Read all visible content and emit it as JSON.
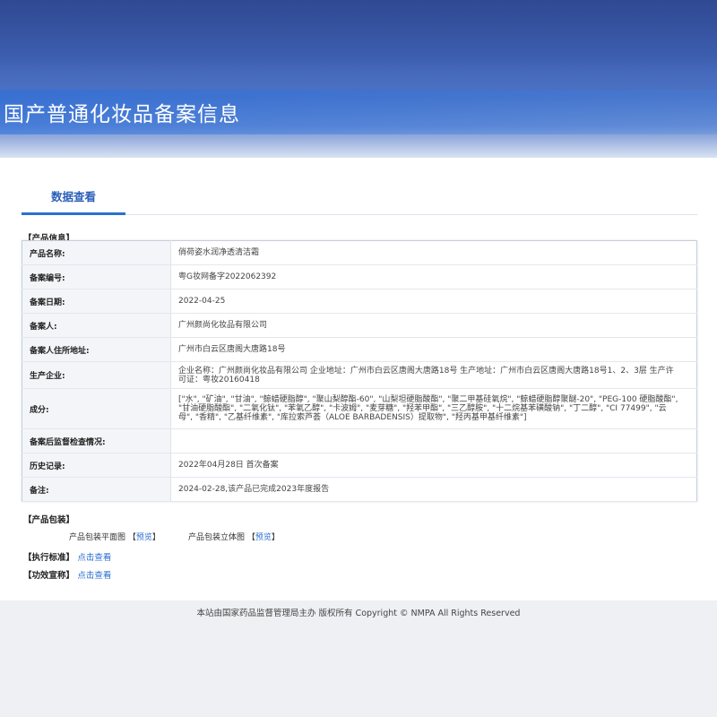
{
  "header": {
    "title": "国产普通化妆品备案信息"
  },
  "tabs": [
    {
      "label": "数据查看"
    }
  ],
  "product_info": {
    "section_label": "【产品信息】",
    "rows": [
      {
        "key": "产品名称:",
        "value": "俏荷姿水润净透清洁霜"
      },
      {
        "key": "备案编号:",
        "value": "粤G妆网备字2022062392"
      },
      {
        "key": "备案日期:",
        "value": "2022-04-25"
      },
      {
        "key": "备案人:",
        "value": "广州颜尚化妆品有限公司"
      },
      {
        "key": "备案人住所地址:",
        "value": "广州市白云区唐阁大唐路18号"
      },
      {
        "key": "生产企业:",
        "value": "企业名称：广州颜尚化妆品有限公司 企业地址：广州市白云区唐阁大唐路18号 生产地址：广州市白云区唐阁大唐路18号1、2、3层 生产许可证：粤妆20160418"
      },
      {
        "key": "成分:",
        "value": "[\"水\", \"矿油\", \"甘油\", \"鲸蜡硬脂醇\", \"聚山梨醇酯-60\", \"山梨坦硬脂酸酯\", \"聚二甲基硅氧烷\", \"鲸蜡硬脂醇聚醚-20\", \"PEG-100 硬脂酸酯\", \"甘油硬脂酸酯\", \"二氧化钛\", \"苯氧乙醇\", \"卡波姆\", \"麦芽糖\", \"羟苯甲酯\", \"三乙醇胺\", \"十二烷基苯磺酸钠\", \"丁二醇\", \"CI 77499\", \"云母\", \"香精\", \"乙基纤维素\", \"库拉索芦荟（ALOE BARBADENSIS）提取物\", \"羟丙基甲基纤维素\"]"
      },
      {
        "key": "备案后监督检查情况:",
        "value": ""
      },
      {
        "key": "历史记录:",
        "value": "2022年04月28日 首次备案"
      },
      {
        "key": "备注:",
        "value": "2024-02-28,该产品已完成2023年度报告"
      }
    ]
  },
  "packaging": {
    "section_label": "【产品包装】",
    "flat_label": "产品包装平面图",
    "cube_label": "产品包装立体图",
    "preview_link": "预览",
    "bracket_open": "【",
    "bracket_close": "】"
  },
  "standard": {
    "section_label": "【执行标准】",
    "link": "点击查看"
  },
  "efficacy": {
    "section_label": "【功效宣称】",
    "link": "点击查看"
  },
  "footer": {
    "text": "本站由国家药品监督管理局主办 版权所有 Copyright © NMPA All Rights Reserved"
  }
}
